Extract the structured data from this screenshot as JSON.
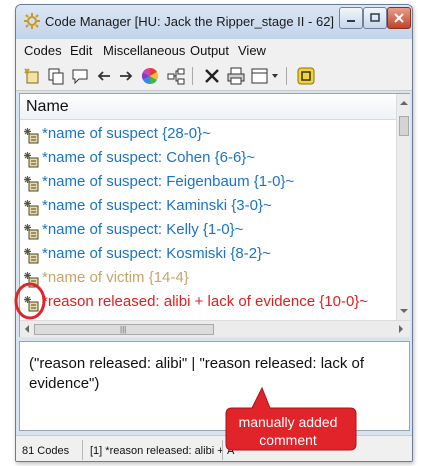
{
  "window": {
    "title": "Code Manager [HU: Jack the Ripper_stage II - 62]"
  },
  "menubar": {
    "items": [
      "Codes",
      "Edit",
      "Miscellaneous",
      "Output",
      "View"
    ]
  },
  "toolbar": {
    "icons": [
      "new-code-icon",
      "copy-icon",
      "comment-icon",
      "back-arrow-icon",
      "forward-arrow-icon",
      "color-wheel-icon",
      "network-icon",
      "delete-icon",
      "print-icon",
      "view-dropdown-icon",
      "close-window-icon"
    ]
  },
  "list": {
    "header": "Name",
    "rows": [
      {
        "label": "*name of suspect {28-0}~",
        "color": "#1b74c9"
      },
      {
        "label": "*name of suspect: Cohen {6-6}~",
        "color": "#1b74c9"
      },
      {
        "label": "*name of suspect: Feigenbaum {1-0}~",
        "color": "#1b74c9"
      },
      {
        "label": "*name of suspect: Kaminski {3-0}~",
        "color": "#1b74c9"
      },
      {
        "label": "*name of suspect: Kelly {1-0}~",
        "color": "#1b74c9"
      },
      {
        "label": "*name of suspect: Kosmiski {8-2}~",
        "color": "#1b74c9"
      },
      {
        "label": "*name of victim {14-4}",
        "color": "#c7a46a"
      },
      {
        "label": "*reason released: alibi +  lack of evidence {10-0}~",
        "color": "#e02020"
      }
    ]
  },
  "comment": {
    "text": "(\"reason released: alibi\" | \"reason released: lack of evidence\")"
  },
  "statusbar": {
    "count": "81 Codes",
    "selection": "[1] *reason released: alibi +",
    "extra": "A"
  },
  "callout": {
    "text": "manually added comment",
    "color": "#e0242a"
  }
}
